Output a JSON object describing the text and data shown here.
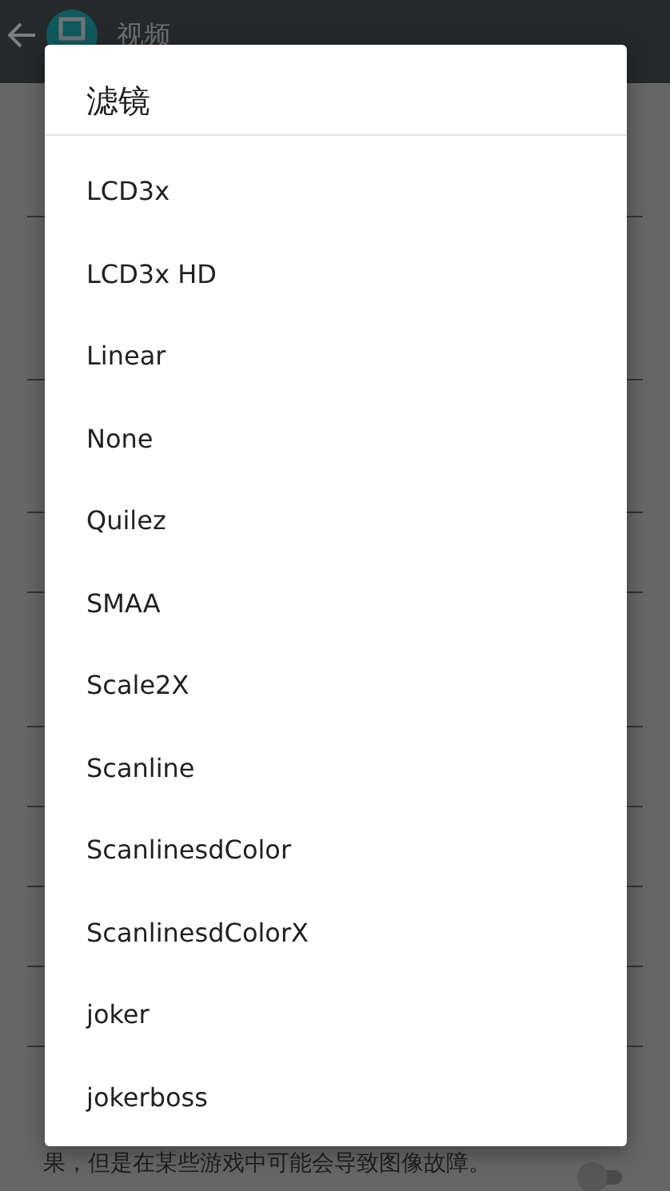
{
  "app_bar": {
    "title": "视频"
  },
  "background": {
    "description_lines": [
      "果，但是在某些游戏中可能会导致图像故障。"
    ],
    "toggle": {
      "on": false
    }
  },
  "dialog": {
    "title": "滤镜",
    "options": [
      {
        "label": "LCD3x"
      },
      {
        "label": "LCD3x HD"
      },
      {
        "label": "Linear"
      },
      {
        "label": "None"
      },
      {
        "label": "Quilez"
      },
      {
        "label": "SMAA"
      },
      {
        "label": "Scale2X"
      },
      {
        "label": "Scanline"
      },
      {
        "label": "ScanlinesdColor"
      },
      {
        "label": "ScanlinesdColorX"
      },
      {
        "label": "joker"
      },
      {
        "label": "jokerboss"
      }
    ]
  }
}
